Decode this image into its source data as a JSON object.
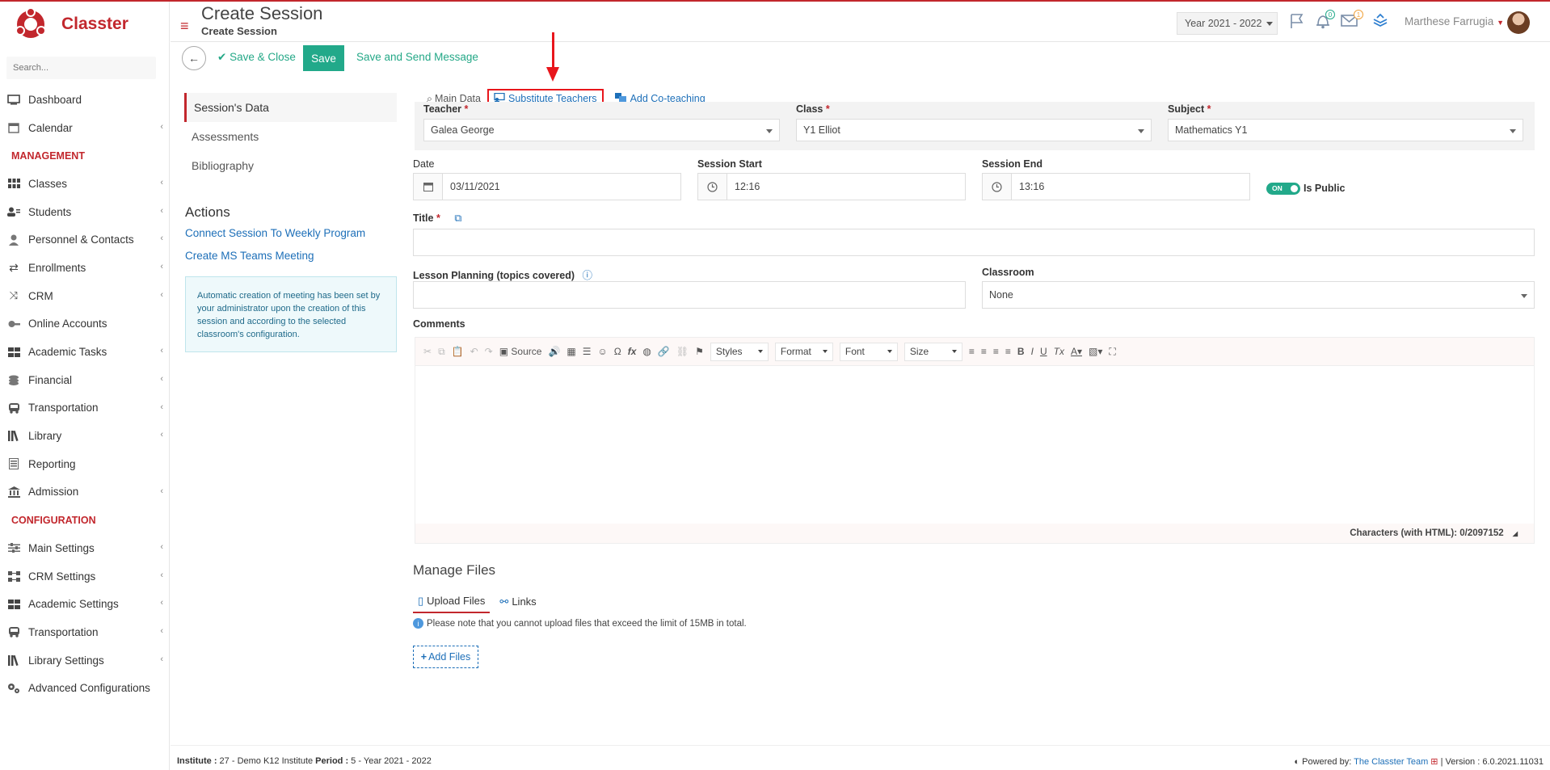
{
  "app": {
    "name": "Classter"
  },
  "sidebar": {
    "search_placeholder": "Search...",
    "items": [
      {
        "label": "Dashboard",
        "icon": "monitor-icon",
        "chevron": false
      },
      {
        "label": "Calendar",
        "icon": "calendar-icon",
        "chevron": true
      }
    ],
    "management_label": "MANAGEMENT",
    "management": [
      {
        "label": "Classes",
        "icon": "grid-icon",
        "chevron": true
      },
      {
        "label": "Students",
        "icon": "users-icon",
        "chevron": true
      },
      {
        "label": "Personnel & Contacts",
        "icon": "person-icon",
        "chevron": true
      },
      {
        "label": "Enrollments",
        "icon": "exchange-icon",
        "chevron": true
      },
      {
        "label": "CRM",
        "icon": "shuffle-icon",
        "chevron": true
      },
      {
        "label": "Online Accounts",
        "icon": "key-icon",
        "chevron": false
      },
      {
        "label": "Academic Tasks",
        "icon": "grid-icon",
        "chevron": true
      },
      {
        "label": "Financial",
        "icon": "coins-icon",
        "chevron": true
      },
      {
        "label": "Transportation",
        "icon": "bus-icon",
        "chevron": true
      },
      {
        "label": "Library",
        "icon": "books-icon",
        "chevron": true
      },
      {
        "label": "Reporting",
        "icon": "report-icon",
        "chevron": false
      },
      {
        "label": "Admission",
        "icon": "bank-icon",
        "chevron": true
      }
    ],
    "configuration_label": "CONFIGURATION",
    "configuration": [
      {
        "label": "Main Settings",
        "icon": "sliders-icon",
        "chevron": true
      },
      {
        "label": "CRM Settings",
        "icon": "nodes-icon",
        "chevron": true
      },
      {
        "label": "Academic Settings",
        "icon": "grid-icon",
        "chevron": true
      },
      {
        "label": "Transportation",
        "icon": "bus-icon",
        "chevron": true
      },
      {
        "label": "Library Settings",
        "icon": "books-icon",
        "chevron": true
      },
      {
        "label": "Advanced Configurations",
        "icon": "gears-icon",
        "chevron": false
      }
    ]
  },
  "header": {
    "title": "Create Session",
    "subtitle": "Create Session",
    "year": "Year 2021 - 2022",
    "notifications_count": "0",
    "messages_count": "1",
    "user_name": "Marthese Farrugia"
  },
  "toolbar": {
    "save_close": "Save & Close",
    "save": "Save",
    "save_send": "Save and Send Message"
  },
  "left_tabs": [
    "Session's Data",
    "Assessments",
    "Bibliography"
  ],
  "actions": {
    "title": "Actions",
    "links": [
      "Connect Session To Weekly Program",
      "Create MS Teams Meeting"
    ],
    "info": "Automatic creation of meeting has been set by your administrator upon the creation of this session and according to the selected classroom's configuration."
  },
  "form_tabs": [
    "Main Data",
    "Substitute Teachers",
    "Add Co-teaching"
  ],
  "form": {
    "teacher_label": "Teacher",
    "teacher_value": "Galea George",
    "class_label": "Class",
    "class_value": "Y1 Elliot",
    "subject_label": "Subject",
    "subject_value": "Mathematics Y1",
    "date_label": "Date",
    "date_value": "03/11/2021",
    "start_label": "Session Start",
    "start_value": "12:16",
    "end_label": "Session End",
    "end_value": "13:16",
    "toggle_text": "ON",
    "public_label": "Is Public",
    "title_label": "Title",
    "title_value": "",
    "lesson_label": "Lesson Planning (topics covered)",
    "lesson_value": "",
    "classroom_label": "Classroom",
    "classroom_value": "None",
    "comments_label": "Comments",
    "required_mark": "*"
  },
  "editor": {
    "source": "Source",
    "styles": "Styles",
    "format": "Format",
    "font": "Font",
    "size": "Size",
    "chars": "Characters (with HTML): 0/2097152"
  },
  "files": {
    "title": "Manage Files",
    "tabs": [
      "Upload Files",
      "Links"
    ],
    "note": "Please note that you cannot upload files that exceed the limit of 15MB in total.",
    "add": "Add Files"
  },
  "footer": {
    "institute_label": "Institute :",
    "institute_value": " 27 - Demo K12 Institute ",
    "period_label": "Period :",
    "period_value": " 5 - Year 2021 - 2022",
    "powered_label": "Powered by: ",
    "powered_link": "The Classter Team",
    "version": " | Version : 6.0.2021.11031"
  },
  "colors": {
    "brand": "#c2272d",
    "accent": "#22a98a",
    "link": "#1d6fb8",
    "highlight": "#e8161c"
  }
}
